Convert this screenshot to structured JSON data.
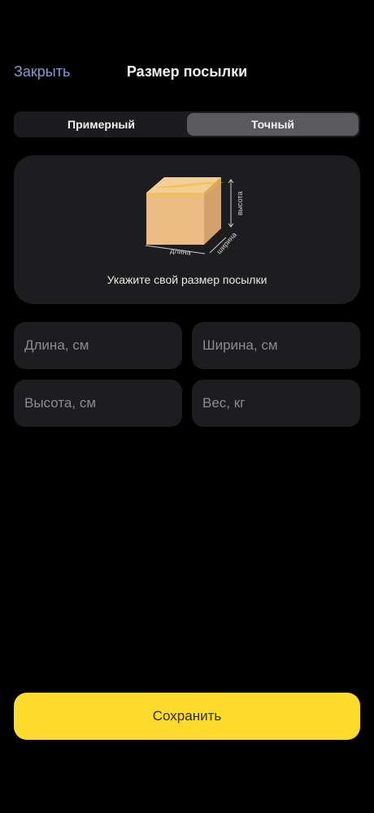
{
  "header": {
    "close_label": "Закрыть",
    "title": "Размер посылки"
  },
  "segmented": {
    "options": [
      "Примерный",
      "Точный"
    ],
    "selected": "Точный"
  },
  "illustration": {
    "label_length": "длина",
    "label_width": "ширина",
    "label_height": "высота",
    "caption": "Укажите свой размер посылки"
  },
  "fields": {
    "length_placeholder": "Длина, см",
    "width_placeholder": "Ширина, см",
    "height_placeholder": "Высота, см",
    "weight_placeholder": "Вес, кг"
  },
  "save_label": "Сохранить",
  "colors": {
    "accent_link": "#8c97d6",
    "save_button": "#fddb2c",
    "background": "#000000",
    "card": "#1d1d1f"
  }
}
